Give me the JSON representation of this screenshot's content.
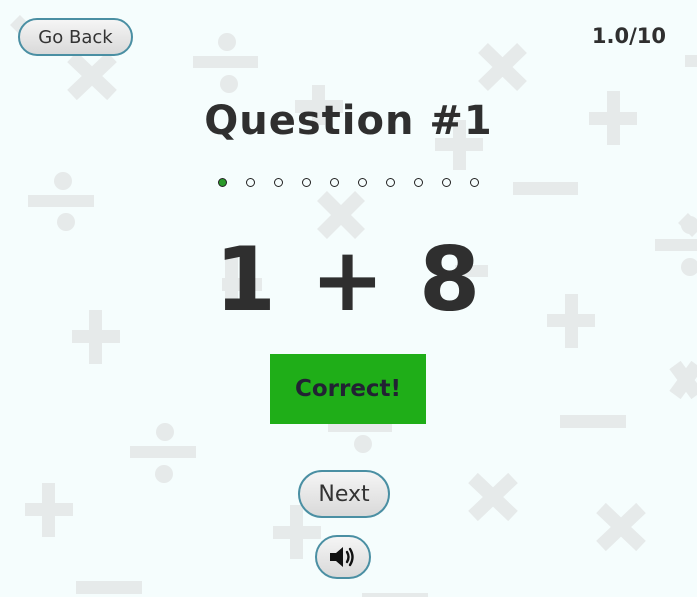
{
  "header": {
    "back_label": "Go Back",
    "score": "1.0/10"
  },
  "question": {
    "title": "Question #1",
    "problem": "1 + 8"
  },
  "progress": {
    "total": 10,
    "completed": 1
  },
  "feedback": {
    "label": "Correct!",
    "color": "#1fae18"
  },
  "controls": {
    "next_label": "Next",
    "sound_icon": "speaker-icon"
  },
  "colors": {
    "background": "#f5fdfd",
    "button_border": "#4a8fa3",
    "progress_done": "#2a9a2a"
  }
}
